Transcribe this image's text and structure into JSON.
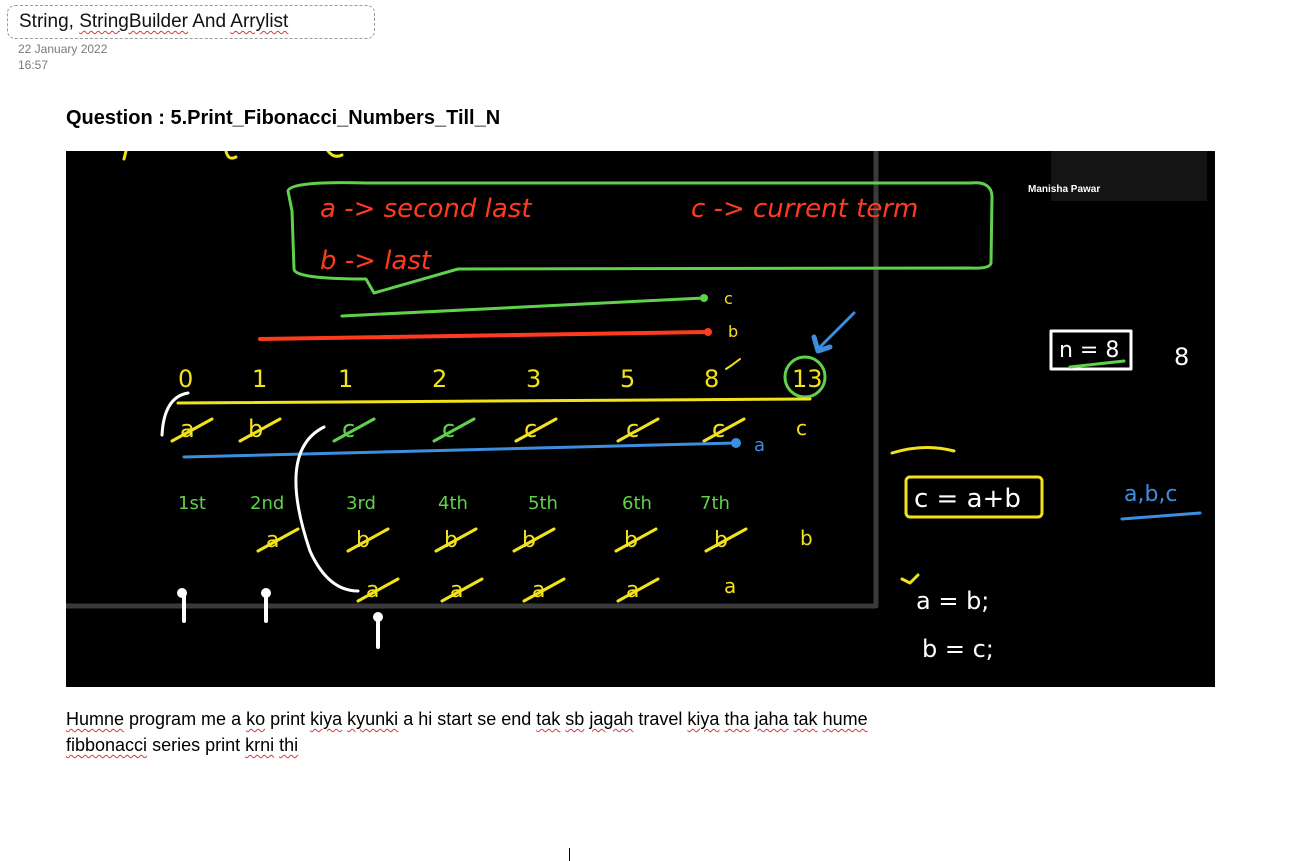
{
  "page": {
    "title_prefix": "String, ",
    "title_stringbuilder": "StringBuilder",
    "title_and": " And ",
    "title_arrylist": "Arrylist",
    "date": "22 January 2022",
    "time": "16:57"
  },
  "question": "Question  : 5.Print_Fibonacci_Numbers_Till_N",
  "board": {
    "participant_name": "Manisha Pawar",
    "def_a": "a -> second last",
    "def_c": "c -> current term",
    "def_b": "b -> last",
    "label_c": "c",
    "label_b": "b",
    "fib_numbers": [
      "0",
      "1",
      "1",
      "2",
      "3",
      "5",
      "8",
      "13"
    ],
    "ordinals": [
      "1st",
      "2nd",
      "3rd",
      "4th",
      "5th",
      "6th",
      "7th"
    ],
    "n_box": "n = 8",
    "n_value": "8",
    "formula": "c = a+b",
    "vars": "a,b,c",
    "assign_a": "a = b;",
    "assign_b": "b = c;",
    "row_c_letters": [
      "a",
      "b",
      "c",
      "c",
      "c",
      "c",
      "c",
      "c"
    ],
    "row_a_end": "a",
    "row_b_letters": [
      "a",
      "b",
      "b",
      "b",
      "b",
      "b",
      "b"
    ],
    "row_a_letters": [
      "a",
      "a",
      "a",
      "a",
      "a"
    ],
    "colors": {
      "yellow": "#f2e21b",
      "green": "#5fd14a",
      "red": "#ff3b1f",
      "blue": "#3c8fe0",
      "white": "#ffffff"
    }
  },
  "note": {
    "w1": "Humne",
    "w2": " program me a ",
    "w3": "ko",
    "w4": " print ",
    "w5": "kiya",
    "w6": " ",
    "w7": "kyunki",
    "w8": " a  hi start se end ",
    "w9": "tak",
    "w10": " ",
    "w11": "sb",
    "w12": " ",
    "w13": "jagah",
    "w14": " travel ",
    "w15": "kiya",
    "w16": " ",
    "w17": "tha",
    "w18": " ",
    "w19": "jaha",
    "w20": "  ",
    "w21": "tak",
    "w22": " ",
    "w23": "hume",
    "l2w1": "fibbonacci",
    "l2w2": " series  print ",
    "l2w3": "krni",
    "l2w4": " ",
    "l2w5": "thi"
  }
}
